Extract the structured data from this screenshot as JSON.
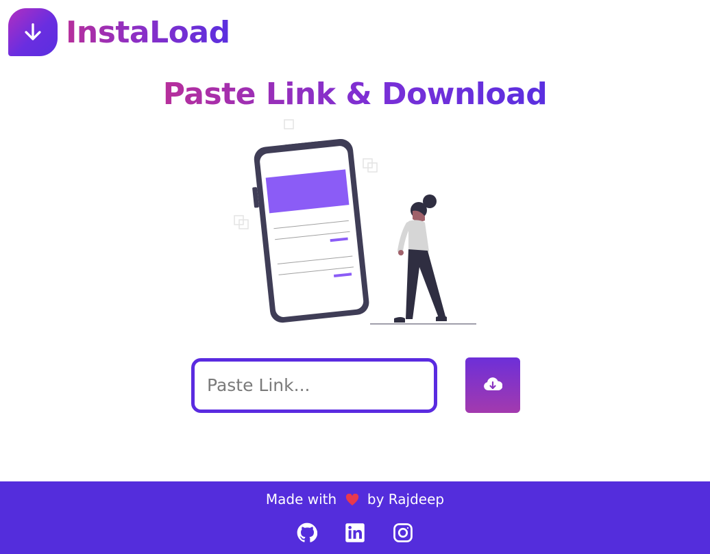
{
  "brand": {
    "name": "InstaLoad",
    "logo_icon": "download-arrow-icon"
  },
  "main": {
    "headline": "Paste Link & Download",
    "illustration": "person-with-phone-illustration",
    "input_placeholder": "Paste Link...",
    "input_value": "",
    "download_button_icon": "cloud-download-icon"
  },
  "footer": {
    "made_with": "Made with",
    "by": "by Rajdeep",
    "heart_icon": "heart-icon",
    "socials": [
      {
        "name": "github",
        "icon": "github-icon"
      },
      {
        "name": "linkedin",
        "icon": "linkedin-icon"
      },
      {
        "name": "instagram",
        "icon": "instagram-icon"
      }
    ]
  },
  "colors": {
    "primary": "#542ddc",
    "accent_pink": "#b72f9b",
    "illustration_purple": "#8b5cf6",
    "illustration_dark": "#3f3d56"
  }
}
